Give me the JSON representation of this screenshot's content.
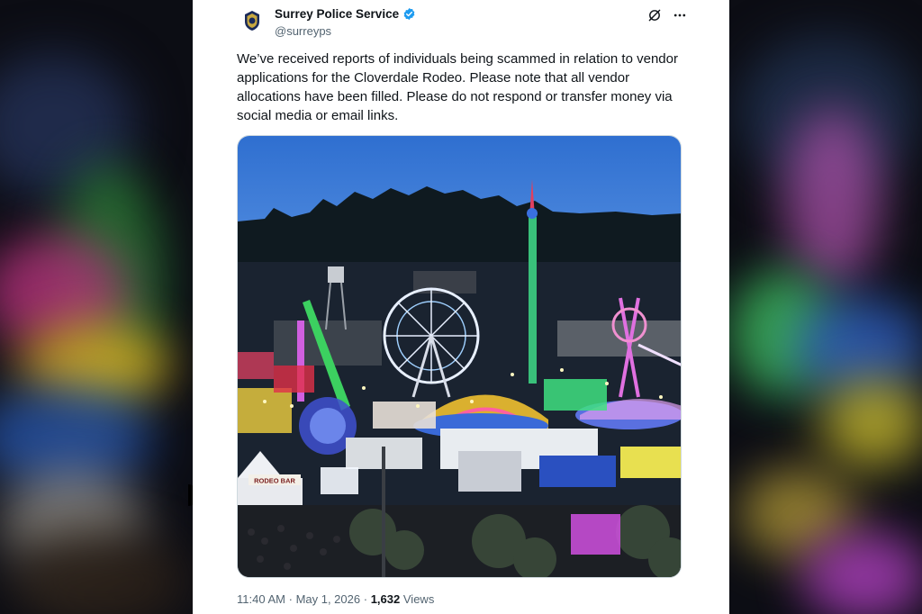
{
  "tweet": {
    "author_name": "Surrey Police Service",
    "author_handle": "@surreyps",
    "text": "We’ve received reports of individuals being scammed in relation to vendor applications for the Cloverdale Rodeo. Please note that all vendor allocations have been filled. Please do not respond or transfer money via social media or email links.",
    "time": "11:40 AM",
    "separator": "·",
    "date": "May 1, 2026",
    "views_count": "1,632",
    "views_label": "Views"
  },
  "photo": {
    "sign_text": "RODEO BAR"
  },
  "icons": {
    "avatar": "police-badge-icon",
    "verified": "verified-badge-icon",
    "grok": "grok-icon",
    "more": "more-options-icon"
  },
  "colors": {
    "verified": "#1d9bf0",
    "text": "#0f1419",
    "muted": "#536471"
  }
}
